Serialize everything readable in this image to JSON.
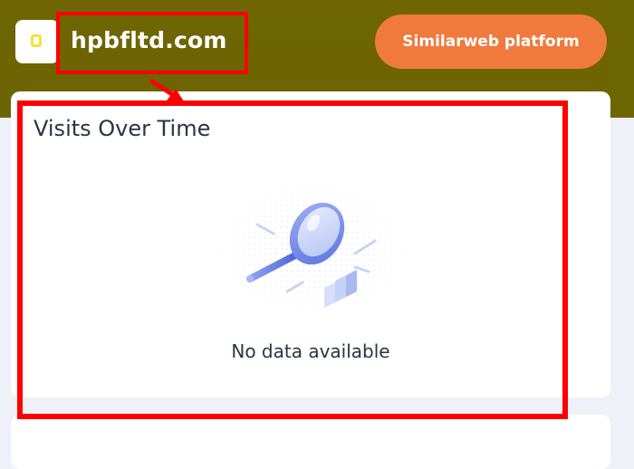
{
  "header": {
    "domain": "hpbfltd.com",
    "platform_button_label": "Similarweb platform"
  },
  "card": {
    "title": "Visits Over Time",
    "empty_state_text": "No data available"
  },
  "colors": {
    "header_bg": "#6f6505",
    "button_bg": "#f07a3e",
    "annotation": "#ff0000",
    "logo_accent": "#f2e33a"
  },
  "icons": {
    "logo": "square-logo-icon",
    "empty_state": "magnifier-illustration-icon",
    "annotation_arrow": "arrow-icon"
  }
}
